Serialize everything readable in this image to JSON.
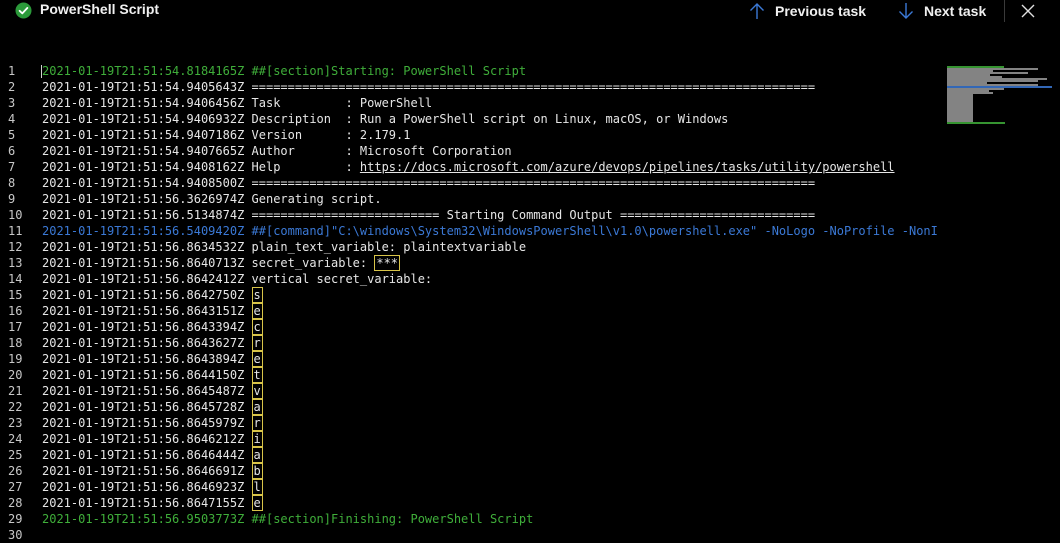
{
  "header": {
    "title": "PowerShell Script",
    "prev_label": "Previous task",
    "next_label": "Next task",
    "status_color": "#2b9a3a"
  },
  "log": [
    {
      "n": "1",
      "ts": "2021-01-19T21:51:54.8184165Z",
      "text": "##[section]Starting: PowerShell Script",
      "style": "green"
    },
    {
      "n": "2",
      "ts": "2021-01-19T21:51:54.9405643Z",
      "text": "==============================================================================",
      "style": "plain"
    },
    {
      "n": "3",
      "ts": "2021-01-19T21:51:54.9406456Z",
      "text": "Task         : PowerShell",
      "style": "plain"
    },
    {
      "n": "4",
      "ts": "2021-01-19T21:51:54.9406932Z",
      "text": "Description  : Run a PowerShell script on Linux, macOS, or Windows",
      "style": "plain"
    },
    {
      "n": "5",
      "ts": "2021-01-19T21:51:54.9407186Z",
      "text": "Version      : 2.179.1",
      "style": "plain"
    },
    {
      "n": "6",
      "ts": "2021-01-19T21:51:54.9407665Z",
      "text": "Author       : Microsoft Corporation",
      "style": "plain"
    },
    {
      "n": "7",
      "ts": "2021-01-19T21:51:54.9408162Z",
      "text": "Help         : ",
      "link": "https://docs.microsoft.com/azure/devops/pipelines/tasks/utility/powershell",
      "style": "plain"
    },
    {
      "n": "8",
      "ts": "2021-01-19T21:51:54.9408500Z",
      "text": "==============================================================================",
      "style": "plain"
    },
    {
      "n": "9",
      "ts": "2021-01-19T21:51:56.3626974Z",
      "text": "Generating script.",
      "style": "plain"
    },
    {
      "n": "10",
      "ts": "2021-01-19T21:51:56.5134874Z",
      "text": "========================== Starting Command Output ===========================",
      "style": "plain"
    },
    {
      "n": "11",
      "ts": "2021-01-19T21:51:56.5409420Z",
      "text": "##[command]\"C:\\windows\\System32\\WindowsPowerShell\\v1.0\\powershell.exe\" -NoLogo -NoProfile -NonI",
      "style": "blue"
    },
    {
      "n": "12",
      "ts": "2021-01-19T21:51:56.8634532Z",
      "text": "plain_text_variable: plaintextvariable",
      "style": "plain"
    },
    {
      "n": "13",
      "ts": "2021-01-19T21:51:56.8640713Z",
      "text": "secret_variable: ",
      "masked": "***",
      "style": "plain"
    },
    {
      "n": "14",
      "ts": "2021-01-19T21:51:56.8642412Z",
      "text": "vertical secret_variable:",
      "style": "plain"
    },
    {
      "n": "15",
      "ts": "2021-01-19T21:51:56.8642750Z",
      "text": "",
      "masked": "s",
      "style": "plain"
    },
    {
      "n": "16",
      "ts": "2021-01-19T21:51:56.8643151Z",
      "text": "",
      "masked": "e",
      "style": "plain"
    },
    {
      "n": "17",
      "ts": "2021-01-19T21:51:56.8643394Z",
      "text": "",
      "masked": "c",
      "style": "plain"
    },
    {
      "n": "18",
      "ts": "2021-01-19T21:51:56.8643627Z",
      "text": "",
      "masked": "r",
      "style": "plain"
    },
    {
      "n": "19",
      "ts": "2021-01-19T21:51:56.8643894Z",
      "text": "",
      "masked": "e",
      "style": "plain"
    },
    {
      "n": "20",
      "ts": "2021-01-19T21:51:56.8644150Z",
      "text": "",
      "masked": "t",
      "style": "plain"
    },
    {
      "n": "21",
      "ts": "2021-01-19T21:51:56.8645487Z",
      "text": "",
      "masked": "v",
      "style": "plain"
    },
    {
      "n": "22",
      "ts": "2021-01-19T21:51:56.8645728Z",
      "text": "",
      "masked": "a",
      "style": "plain"
    },
    {
      "n": "23",
      "ts": "2021-01-19T21:51:56.8645979Z",
      "text": "",
      "masked": "r",
      "style": "plain"
    },
    {
      "n": "24",
      "ts": "2021-01-19T21:51:56.8646212Z",
      "text": "",
      "masked": "i",
      "style": "plain"
    },
    {
      "n": "25",
      "ts": "2021-01-19T21:51:56.8646444Z",
      "text": "",
      "masked": "a",
      "style": "plain"
    },
    {
      "n": "26",
      "ts": "2021-01-19T21:51:56.8646691Z",
      "text": "",
      "masked": "b",
      "style": "plain"
    },
    {
      "n": "27",
      "ts": "2021-01-19T21:51:56.8646923Z",
      "text": "",
      "masked": "l",
      "style": "plain"
    },
    {
      "n": "28",
      "ts": "2021-01-19T21:51:56.8647155Z",
      "text": "",
      "masked": "e",
      "style": "plain"
    },
    {
      "n": "29",
      "ts": "2021-01-19T21:51:56.9503773Z",
      "text": "##[section]Finishing: PowerShell Script",
      "style": "green"
    },
    {
      "n": "30",
      "ts": "",
      "text": "",
      "style": "plain"
    }
  ],
  "colors": {
    "green": "#3fae3a",
    "blue": "#3b79d6",
    "mask_border": "#d8c449",
    "background": "#000000"
  }
}
